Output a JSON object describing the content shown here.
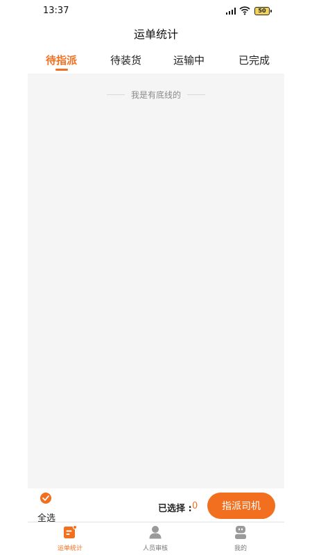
{
  "status_bar": {
    "time": "13:37",
    "battery": "50"
  },
  "header": {
    "title": "运单统计"
  },
  "tabs": [
    {
      "label": "待指派",
      "active": true
    },
    {
      "label": "待装货",
      "active": false
    },
    {
      "label": "运输中",
      "active": false
    },
    {
      "label": "已完成",
      "active": false
    }
  ],
  "content": {
    "no_more_text": "我是有底线的"
  },
  "action_bar": {
    "select_all_label": "全选",
    "selected_label": "已选择 :",
    "selected_count": "0",
    "assign_button": "指派司机"
  },
  "bottom_nav": [
    {
      "label": "运单统计",
      "icon": "waybill-icon",
      "active": true
    },
    {
      "label": "人员审核",
      "icon": "person-icon",
      "active": false
    },
    {
      "label": "我的",
      "icon": "profile-icon",
      "active": false
    }
  ],
  "colors": {
    "accent": "#f26f1f",
    "content_bg": "#f5f5f5"
  }
}
